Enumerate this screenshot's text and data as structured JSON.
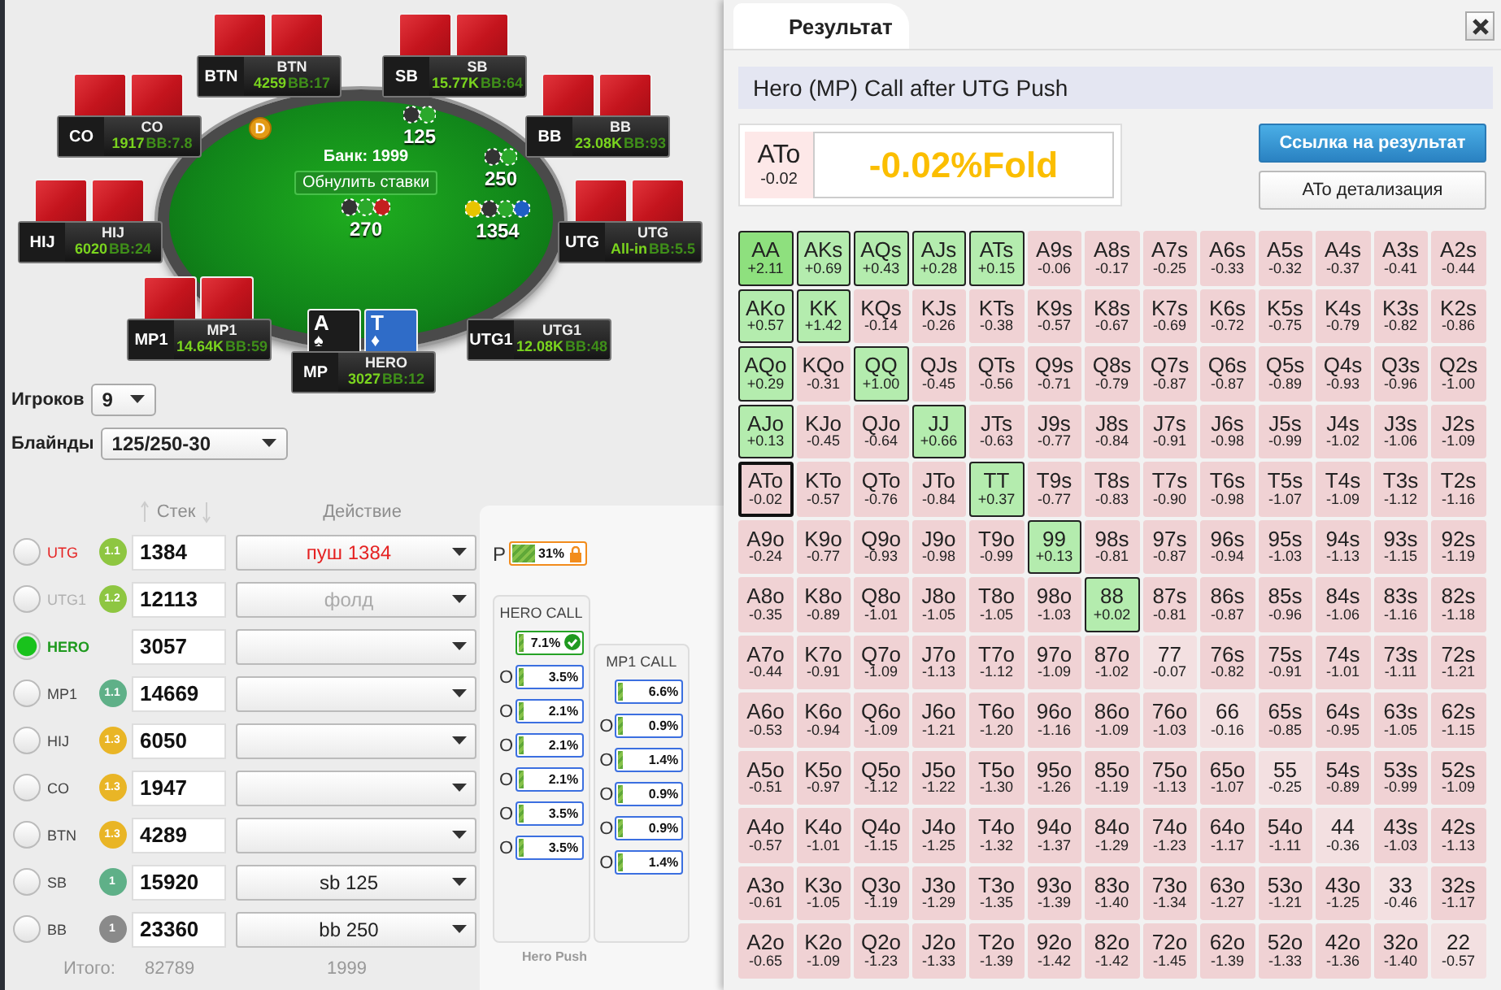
{
  "table": {
    "seats": [
      {
        "position": "BTN",
        "name": "BTN",
        "stack": "4259",
        "bb": "BB:17",
        "cards": {
          "kind": "back"
        }
      },
      {
        "position": "SB",
        "name": "SB",
        "stack": "15.77K",
        "bb": "BB:64",
        "cards": {
          "kind": "back"
        }
      },
      {
        "position": "CO",
        "name": "CO",
        "stack": "1917",
        "bb": "BB:7.8",
        "cards": {
          "kind": "back"
        }
      },
      {
        "position": "BB",
        "name": "BB",
        "stack": "23.08K",
        "bb": "BB:93",
        "cards": {
          "kind": "back"
        }
      },
      {
        "position": "HIJ",
        "name": "HIJ",
        "stack": "6020",
        "bb": "BB:24",
        "cards": {
          "kind": "back"
        }
      },
      {
        "position": "UTG",
        "name": "UTG",
        "stack": "All-in",
        "bb": "BB:5.5",
        "cards": {
          "kind": "back"
        }
      },
      {
        "position": "MP1",
        "name": "MP1",
        "stack": "14.64K",
        "bb": "BB:59",
        "cards": {
          "kind": "back"
        }
      },
      {
        "position": "UTG1",
        "name": "UTG1",
        "stack": "12.08K",
        "bb": "BB:48",
        "cards": {
          "kind": "none"
        }
      },
      {
        "position": "MP",
        "name": "HERO",
        "stack": "3027",
        "bb": "BB:12",
        "cards": {
          "kind": "face",
          "items": [
            {
              "rank": "A",
              "suit": "♠",
              "color": "#1c1c1c"
            },
            {
              "rank": "T",
              "suit": "♦",
              "color": "#2f6cc8"
            }
          ]
        }
      }
    ],
    "bets": [
      {
        "amount": "125"
      },
      {
        "amount": "250"
      },
      {
        "amount": "1354"
      },
      {
        "amount": "270"
      }
    ],
    "dealer_button": "D",
    "pot": "Банк: 1999",
    "reset_button": "Обнулить ставки"
  },
  "settings": {
    "players": {
      "label": "Игроков",
      "value": "9"
    },
    "blinds": {
      "label": "Блайнды",
      "value": "125/250-30"
    }
  },
  "players": {
    "stack_header": "Стек",
    "action_header": "Действие",
    "rows": [
      {
        "position": "UTG",
        "kind": "push",
        "selected": false,
        "badge": {
          "text": "1.1",
          "color": "#8ec641"
        },
        "stack": "1384",
        "action": "пуш 1384"
      },
      {
        "position": "UTG1",
        "kind": "fold",
        "selected": false,
        "badge": {
          "text": "1.2",
          "color": "#8ec641"
        },
        "stack": "12113",
        "action": "фолд"
      },
      {
        "position": "HERO",
        "kind": "hero",
        "selected": true,
        "stack": "3057"
      },
      {
        "position": "MP1",
        "kind": "waiting",
        "selected": false,
        "badge": {
          "text": "1.1",
          "color": "#5fb088"
        },
        "stack": "14669"
      },
      {
        "position": "HIJ",
        "kind": "waiting",
        "selected": false,
        "badge": {
          "text": "1.3",
          "color": "#e9b526"
        },
        "stack": "6050"
      },
      {
        "position": "CO",
        "kind": "waiting",
        "selected": false,
        "badge": {
          "text": "1.3",
          "color": "#e9b526"
        },
        "stack": "1947"
      },
      {
        "position": "BTN",
        "kind": "waiting",
        "selected": false,
        "badge": {
          "text": "1.3",
          "color": "#e9b526"
        },
        "stack": "4289"
      },
      {
        "position": "SB",
        "kind": "waiting",
        "selected": false,
        "badge": {
          "text": "1",
          "color": "#5fb088"
        },
        "stack": "15920",
        "action": "sb 125"
      },
      {
        "position": "BB",
        "kind": "waiting",
        "selected": false,
        "badge": {
          "text": "1",
          "color": "#8a8a8a"
        },
        "stack": "23360",
        "action": "bb 250"
      }
    ],
    "totals": {
      "label": "Итого:",
      "stack": "82789",
      "bets": "1999"
    }
  },
  "range_panel": {
    "push": {
      "label": "P",
      "value": "31%",
      "level": 0.31,
      "locked": true
    },
    "columns": [
      {
        "title": "HERO CALL",
        "rows": [
          {
            "value": "7.1%",
            "level": 0.071,
            "checked": true
          },
          {
            "prefix": "O",
            "value": "3.5%",
            "level": 0.035,
            "checked": false
          },
          {
            "prefix": "O",
            "value": "2.1%",
            "level": 0.021,
            "checked": false
          },
          {
            "prefix": "O",
            "value": "2.1%",
            "level": 0.021,
            "checked": false
          },
          {
            "prefix": "O",
            "value": "2.1%",
            "level": 0.021,
            "checked": false
          },
          {
            "prefix": "O",
            "value": "3.5%",
            "level": 0.035,
            "checked": false
          },
          {
            "prefix": "O",
            "value": "3.5%",
            "level": 0.035,
            "checked": false
          }
        ]
      },
      {
        "title": "MP1 CALL",
        "rows": [
          {
            "value": "6.6%",
            "level": 0.066,
            "checked": false
          },
          {
            "prefix": "O",
            "value": "0.9%",
            "level": 0.009,
            "checked": false
          },
          {
            "prefix": "O",
            "value": "1.4%",
            "level": 0.014,
            "checked": false
          },
          {
            "prefix": "O",
            "value": "0.9%",
            "level": 0.009,
            "checked": false
          },
          {
            "prefix": "O",
            "value": "0.9%",
            "level": 0.009,
            "checked": false
          },
          {
            "prefix": "O",
            "value": "1.4%",
            "level": 0.014,
            "checked": false
          }
        ]
      }
    ],
    "footer": "Hero Push"
  },
  "result": {
    "tab": {
      "label": "Результат",
      "selected": true
    },
    "title": "Hero (MP) Call after UTG Push",
    "hand": "ATo",
    "hand_ev": "-0.02",
    "verdict": "-0.02%Fold",
    "buttons": [
      {
        "label": "Ссылка на результат",
        "kind": "primary"
      },
      {
        "label": "ATo детализация",
        "kind": "secondary"
      }
    ],
    "grid": [
      [
        {
          "hand": "AA",
          "ev": "+2.11",
          "kind": "call",
          "selected": false
        },
        {
          "hand": "AKs",
          "ev": "+0.69",
          "kind": "call",
          "selected": false
        },
        {
          "hand": "AQs",
          "ev": "+0.43",
          "kind": "call",
          "selected": false
        },
        {
          "hand": "AJs",
          "ev": "+0.28",
          "kind": "call",
          "selected": false
        },
        {
          "hand": "ATs",
          "ev": "+0.15",
          "kind": "call",
          "selected": false
        },
        {
          "hand": "A9s",
          "ev": "-0.06",
          "kind": "fold",
          "selected": false
        },
        {
          "hand": "A8s",
          "ev": "-0.17",
          "kind": "fold",
          "selected": false
        },
        {
          "hand": "A7s",
          "ev": "-0.25",
          "kind": "fold",
          "selected": false
        },
        {
          "hand": "A6s",
          "ev": "-0.33",
          "kind": "fold",
          "selected": false
        },
        {
          "hand": "A5s",
          "ev": "-0.32",
          "kind": "fold",
          "selected": false
        },
        {
          "hand": "A4s",
          "ev": "-0.37",
          "kind": "fold",
          "selected": false
        },
        {
          "hand": "A3s",
          "ev": "-0.41",
          "kind": "fold",
          "selected": false
        },
        {
          "hand": "A2s",
          "ev": "-0.44",
          "kind": "fold",
          "selected": false
        }
      ],
      [
        {
          "hand": "AKo",
          "ev": "+0.57",
          "kind": "call",
          "selected": false
        },
        {
          "hand": "KK",
          "ev": "+1.42",
          "kind": "call",
          "selected": false
        },
        {
          "hand": "KQs",
          "ev": "-0.14",
          "kind": "fold",
          "selected": false
        },
        {
          "hand": "KJs",
          "ev": "-0.26",
          "kind": "fold",
          "selected": false
        },
        {
          "hand": "KTs",
          "ev": "-0.38",
          "kind": "fold",
          "selected": false
        },
        {
          "hand": "K9s",
          "ev": "-0.57",
          "kind": "fold",
          "selected": false
        },
        {
          "hand": "K8s",
          "ev": "-0.67",
          "kind": "fold",
          "selected": false
        },
        {
          "hand": "K7s",
          "ev": "-0.69",
          "kind": "fold",
          "selected": false
        },
        {
          "hand": "K6s",
          "ev": "-0.72",
          "kind": "fold",
          "selected": false
        },
        {
          "hand": "K5s",
          "ev": "-0.75",
          "kind": "fold",
          "selected": false
        },
        {
          "hand": "K4s",
          "ev": "-0.79",
          "kind": "fold",
          "selected": false
        },
        {
          "hand": "K3s",
          "ev": "-0.82",
          "kind": "fold",
          "selected": false
        },
        {
          "hand": "K2s",
          "ev": "-0.86",
          "kind": "fold",
          "selected": false
        }
      ],
      [
        {
          "hand": "AQo",
          "ev": "+0.29",
          "kind": "call",
          "selected": false
        },
        {
          "hand": "KQo",
          "ev": "-0.31",
          "kind": "fold",
          "selected": false
        },
        {
          "hand": "QQ",
          "ev": "+1.00",
          "kind": "call",
          "selected": false
        },
        {
          "hand": "QJs",
          "ev": "-0.45",
          "kind": "fold",
          "selected": false
        },
        {
          "hand": "QTs",
          "ev": "-0.56",
          "kind": "fold",
          "selected": false
        },
        {
          "hand": "Q9s",
          "ev": "-0.71",
          "kind": "fold",
          "selected": false
        },
        {
          "hand": "Q8s",
          "ev": "-0.79",
          "kind": "fold",
          "selected": false
        },
        {
          "hand": "Q7s",
          "ev": "-0.87",
          "kind": "fold",
          "selected": false
        },
        {
          "hand": "Q6s",
          "ev": "-0.87",
          "kind": "fold",
          "selected": false
        },
        {
          "hand": "Q5s",
          "ev": "-0.89",
          "kind": "fold",
          "selected": false
        },
        {
          "hand": "Q4s",
          "ev": "-0.93",
          "kind": "fold",
          "selected": false
        },
        {
          "hand": "Q3s",
          "ev": "-0.96",
          "kind": "fold",
          "selected": false
        },
        {
          "hand": "Q2s",
          "ev": "-1.00",
          "kind": "fold",
          "selected": false
        }
      ],
      [
        {
          "hand": "AJo",
          "ev": "+0.13",
          "kind": "call",
          "selected": false
        },
        {
          "hand": "KJo",
          "ev": "-0.45",
          "kind": "fold",
          "selected": false
        },
        {
          "hand": "QJo",
          "ev": "-0.64",
          "kind": "fold",
          "selected": false
        },
        {
          "hand": "JJ",
          "ev": "+0.66",
          "kind": "call",
          "selected": false
        },
        {
          "hand": "JTs",
          "ev": "-0.63",
          "kind": "fold",
          "selected": false
        },
        {
          "hand": "J9s",
          "ev": "-0.77",
          "kind": "fold",
          "selected": false
        },
        {
          "hand": "J8s",
          "ev": "-0.84",
          "kind": "fold",
          "selected": false
        },
        {
          "hand": "J7s",
          "ev": "-0.91",
          "kind": "fold",
          "selected": false
        },
        {
          "hand": "J6s",
          "ev": "-0.98",
          "kind": "fold",
          "selected": false
        },
        {
          "hand": "J5s",
          "ev": "-0.99",
          "kind": "fold",
          "selected": false
        },
        {
          "hand": "J4s",
          "ev": "-1.02",
          "kind": "fold",
          "selected": false
        },
        {
          "hand": "J3s",
          "ev": "-1.06",
          "kind": "fold",
          "selected": false
        },
        {
          "hand": "J2s",
          "ev": "-1.09",
          "kind": "fold",
          "selected": false
        }
      ],
      [
        {
          "hand": "ATo",
          "ev": "-0.02",
          "kind": "fold",
          "selected": true
        },
        {
          "hand": "KTo",
          "ev": "-0.57",
          "kind": "fold",
          "selected": false
        },
        {
          "hand": "QTo",
          "ev": "-0.76",
          "kind": "fold",
          "selected": false
        },
        {
          "hand": "JTo",
          "ev": "-0.84",
          "kind": "fold",
          "selected": false
        },
        {
          "hand": "TT",
          "ev": "+0.37",
          "kind": "call",
          "selected": false
        },
        {
          "hand": "T9s",
          "ev": "-0.77",
          "kind": "fold",
          "selected": false
        },
        {
          "hand": "T8s",
          "ev": "-0.83",
          "kind": "fold",
          "selected": false
        },
        {
          "hand": "T7s",
          "ev": "-0.90",
          "kind": "fold",
          "selected": false
        },
        {
          "hand": "T6s",
          "ev": "-0.98",
          "kind": "fold",
          "selected": false
        },
        {
          "hand": "T5s",
          "ev": "-1.07",
          "kind": "fold",
          "selected": false
        },
        {
          "hand": "T4s",
          "ev": "-1.09",
          "kind": "fold",
          "selected": false
        },
        {
          "hand": "T3s",
          "ev": "-1.12",
          "kind": "fold",
          "selected": false
        },
        {
          "hand": "T2s",
          "ev": "-1.16",
          "kind": "fold",
          "selected": false
        }
      ],
      [
        {
          "hand": "A9o",
          "ev": "-0.24",
          "kind": "fold",
          "selected": false
        },
        {
          "hand": "K9o",
          "ev": "-0.77",
          "kind": "fold",
          "selected": false
        },
        {
          "hand": "Q9o",
          "ev": "-0.93",
          "kind": "fold",
          "selected": false
        },
        {
          "hand": "J9o",
          "ev": "-0.98",
          "kind": "fold",
          "selected": false
        },
        {
          "hand": "T9o",
          "ev": "-0.99",
          "kind": "fold",
          "selected": false
        },
        {
          "hand": "99",
          "ev": "+0.13",
          "kind": "call",
          "selected": false
        },
        {
          "hand": "98s",
          "ev": "-0.81",
          "kind": "fold",
          "selected": false
        },
        {
          "hand": "97s",
          "ev": "-0.87",
          "kind": "fold",
          "selected": false
        },
        {
          "hand": "96s",
          "ev": "-0.94",
          "kind": "fold",
          "selected": false
        },
        {
          "hand": "95s",
          "ev": "-1.03",
          "kind": "fold",
          "selected": false
        },
        {
          "hand": "94s",
          "ev": "-1.13",
          "kind": "fold",
          "selected": false
        },
        {
          "hand": "93s",
          "ev": "-1.15",
          "kind": "fold",
          "selected": false
        },
        {
          "hand": "92s",
          "ev": "-1.19",
          "kind": "fold",
          "selected": false
        }
      ],
      [
        {
          "hand": "A8o",
          "ev": "-0.35",
          "kind": "fold",
          "selected": false
        },
        {
          "hand": "K8o",
          "ev": "-0.89",
          "kind": "fold",
          "selected": false
        },
        {
          "hand": "Q8o",
          "ev": "-1.01",
          "kind": "fold",
          "selected": false
        },
        {
          "hand": "J8o",
          "ev": "-1.05",
          "kind": "fold",
          "selected": false
        },
        {
          "hand": "T8o",
          "ev": "-1.05",
          "kind": "fold",
          "selected": false
        },
        {
          "hand": "98o",
          "ev": "-1.03",
          "kind": "fold",
          "selected": false
        },
        {
          "hand": "88",
          "ev": "+0.02",
          "kind": "call",
          "selected": false
        },
        {
          "hand": "87s",
          "ev": "-0.81",
          "kind": "fold",
          "selected": false
        },
        {
          "hand": "86s",
          "ev": "-0.87",
          "kind": "fold",
          "selected": false
        },
        {
          "hand": "85s",
          "ev": "-0.96",
          "kind": "fold",
          "selected": false
        },
        {
          "hand": "84s",
          "ev": "-1.06",
          "kind": "fold",
          "selected": false
        },
        {
          "hand": "83s",
          "ev": "-1.16",
          "kind": "fold",
          "selected": false
        },
        {
          "hand": "82s",
          "ev": "-1.18",
          "kind": "fold",
          "selected": false
        }
      ],
      [
        {
          "hand": "A7o",
          "ev": "-0.44",
          "kind": "fold",
          "selected": false
        },
        {
          "hand": "K7o",
          "ev": "-0.91",
          "kind": "fold",
          "selected": false
        },
        {
          "hand": "Q7o",
          "ev": "-1.09",
          "kind": "fold",
          "selected": false
        },
        {
          "hand": "J7o",
          "ev": "-1.13",
          "kind": "fold",
          "selected": false
        },
        {
          "hand": "T7o",
          "ev": "-1.12",
          "kind": "fold",
          "selected": false
        },
        {
          "hand": "97o",
          "ev": "-1.09",
          "kind": "fold",
          "selected": false
        },
        {
          "hand": "87o",
          "ev": "-1.02",
          "kind": "fold",
          "selected": false
        },
        {
          "hand": "77",
          "ev": "-0.07",
          "kind": "fold",
          "selected": false
        },
        {
          "hand": "76s",
          "ev": "-0.82",
          "kind": "fold",
          "selected": false
        },
        {
          "hand": "75s",
          "ev": "-0.91",
          "kind": "fold",
          "selected": false
        },
        {
          "hand": "74s",
          "ev": "-1.01",
          "kind": "fold",
          "selected": false
        },
        {
          "hand": "73s",
          "ev": "-1.11",
          "kind": "fold",
          "selected": false
        },
        {
          "hand": "72s",
          "ev": "-1.21",
          "kind": "fold",
          "selected": false
        }
      ],
      [
        {
          "hand": "A6o",
          "ev": "-0.53",
          "kind": "fold",
          "selected": false
        },
        {
          "hand": "K6o",
          "ev": "-0.94",
          "kind": "fold",
          "selected": false
        },
        {
          "hand": "Q6o",
          "ev": "-1.09",
          "kind": "fold",
          "selected": false
        },
        {
          "hand": "J6o",
          "ev": "-1.21",
          "kind": "fold",
          "selected": false
        },
        {
          "hand": "T6o",
          "ev": "-1.20",
          "kind": "fold",
          "selected": false
        },
        {
          "hand": "96o",
          "ev": "-1.16",
          "kind": "fold",
          "selected": false
        },
        {
          "hand": "86o",
          "ev": "-1.09",
          "kind": "fold",
          "selected": false
        },
        {
          "hand": "76o",
          "ev": "-1.03",
          "kind": "fold",
          "selected": false
        },
        {
          "hand": "66",
          "ev": "-0.16",
          "kind": "fold",
          "selected": false
        },
        {
          "hand": "65s",
          "ev": "-0.85",
          "kind": "fold",
          "selected": false
        },
        {
          "hand": "64s",
          "ev": "-0.95",
          "kind": "fold",
          "selected": false
        },
        {
          "hand": "63s",
          "ev": "-1.05",
          "kind": "fold",
          "selected": false
        },
        {
          "hand": "62s",
          "ev": "-1.15",
          "kind": "fold",
          "selected": false
        }
      ],
      [
        {
          "hand": "A5o",
          "ev": "-0.51",
          "kind": "fold",
          "selected": false
        },
        {
          "hand": "K5o",
          "ev": "-0.97",
          "kind": "fold",
          "selected": false
        },
        {
          "hand": "Q5o",
          "ev": "-1.12",
          "kind": "fold",
          "selected": false
        },
        {
          "hand": "J5o",
          "ev": "-1.22",
          "kind": "fold",
          "selected": false
        },
        {
          "hand": "T5o",
          "ev": "-1.30",
          "kind": "fold",
          "selected": false
        },
        {
          "hand": "95o",
          "ev": "-1.26",
          "kind": "fold",
          "selected": false
        },
        {
          "hand": "85o",
          "ev": "-1.19",
          "kind": "fold",
          "selected": false
        },
        {
          "hand": "75o",
          "ev": "-1.13",
          "kind": "fold",
          "selected": false
        },
        {
          "hand": "65o",
          "ev": "-1.07",
          "kind": "fold",
          "selected": false
        },
        {
          "hand": "55",
          "ev": "-0.25",
          "kind": "fold",
          "selected": false
        },
        {
          "hand": "54s",
          "ev": "-0.89",
          "kind": "fold",
          "selected": false
        },
        {
          "hand": "53s",
          "ev": "-0.99",
          "kind": "fold",
          "selected": false
        },
        {
          "hand": "52s",
          "ev": "-1.09",
          "kind": "fold",
          "selected": false
        }
      ],
      [
        {
          "hand": "A4o",
          "ev": "-0.57",
          "kind": "fold",
          "selected": false
        },
        {
          "hand": "K4o",
          "ev": "-1.01",
          "kind": "fold",
          "selected": false
        },
        {
          "hand": "Q4o",
          "ev": "-1.15",
          "kind": "fold",
          "selected": false
        },
        {
          "hand": "J4o",
          "ev": "-1.25",
          "kind": "fold",
          "selected": false
        },
        {
          "hand": "T4o",
          "ev": "-1.32",
          "kind": "fold",
          "selected": false
        },
        {
          "hand": "94o",
          "ev": "-1.37",
          "kind": "fold",
          "selected": false
        },
        {
          "hand": "84o",
          "ev": "-1.29",
          "kind": "fold",
          "selected": false
        },
        {
          "hand": "74o",
          "ev": "-1.23",
          "kind": "fold",
          "selected": false
        },
        {
          "hand": "64o",
          "ev": "-1.17",
          "kind": "fold",
          "selected": false
        },
        {
          "hand": "54o",
          "ev": "-1.11",
          "kind": "fold",
          "selected": false
        },
        {
          "hand": "44",
          "ev": "-0.36",
          "kind": "fold",
          "selected": false
        },
        {
          "hand": "43s",
          "ev": "-1.03",
          "kind": "fold",
          "selected": false
        },
        {
          "hand": "42s",
          "ev": "-1.13",
          "kind": "fold",
          "selected": false
        }
      ],
      [
        {
          "hand": "A3o",
          "ev": "-0.61",
          "kind": "fold",
          "selected": false
        },
        {
          "hand": "K3o",
          "ev": "-1.05",
          "kind": "fold",
          "selected": false
        },
        {
          "hand": "Q3o",
          "ev": "-1.19",
          "kind": "fold",
          "selected": false
        },
        {
          "hand": "J3o",
          "ev": "-1.29",
          "kind": "fold",
          "selected": false
        },
        {
          "hand": "T3o",
          "ev": "-1.35",
          "kind": "fold",
          "selected": false
        },
        {
          "hand": "93o",
          "ev": "-1.39",
          "kind": "fold",
          "selected": false
        },
        {
          "hand": "83o",
          "ev": "-1.40",
          "kind": "fold",
          "selected": false
        },
        {
          "hand": "73o",
          "ev": "-1.34",
          "kind": "fold",
          "selected": false
        },
        {
          "hand": "63o",
          "ev": "-1.27",
          "kind": "fold",
          "selected": false
        },
        {
          "hand": "53o",
          "ev": "-1.21",
          "kind": "fold",
          "selected": false
        },
        {
          "hand": "43o",
          "ev": "-1.25",
          "kind": "fold",
          "selected": false
        },
        {
          "hand": "33",
          "ev": "-0.46",
          "kind": "fold",
          "selected": false
        },
        {
          "hand": "32s",
          "ev": "-1.17",
          "kind": "fold",
          "selected": false
        }
      ],
      [
        {
          "hand": "A2o",
          "ev": "-0.65",
          "kind": "fold",
          "selected": false
        },
        {
          "hand": "K2o",
          "ev": "-1.09",
          "kind": "fold",
          "selected": false
        },
        {
          "hand": "Q2o",
          "ev": "-1.23",
          "kind": "fold",
          "selected": false
        },
        {
          "hand": "J2o",
          "ev": "-1.33",
          "kind": "fold",
          "selected": false
        },
        {
          "hand": "T2o",
          "ev": "-1.39",
          "kind": "fold",
          "selected": false
        },
        {
          "hand": "92o",
          "ev": "-1.42",
          "kind": "fold",
          "selected": false
        },
        {
          "hand": "82o",
          "ev": "-1.42",
          "kind": "fold",
          "selected": false
        },
        {
          "hand": "72o",
          "ev": "-1.45",
          "kind": "fold",
          "selected": false
        },
        {
          "hand": "62o",
          "ev": "-1.39",
          "kind": "fold",
          "selected": false
        },
        {
          "hand": "52o",
          "ev": "-1.33",
          "kind": "fold",
          "selected": false
        },
        {
          "hand": "42o",
          "ev": "-1.36",
          "kind": "fold",
          "selected": false
        },
        {
          "hand": "32o",
          "ev": "-1.40",
          "kind": "fold",
          "selected": false
        },
        {
          "hand": "22",
          "ev": "-0.57",
          "kind": "fold",
          "selected": false
        }
      ]
    ]
  }
}
